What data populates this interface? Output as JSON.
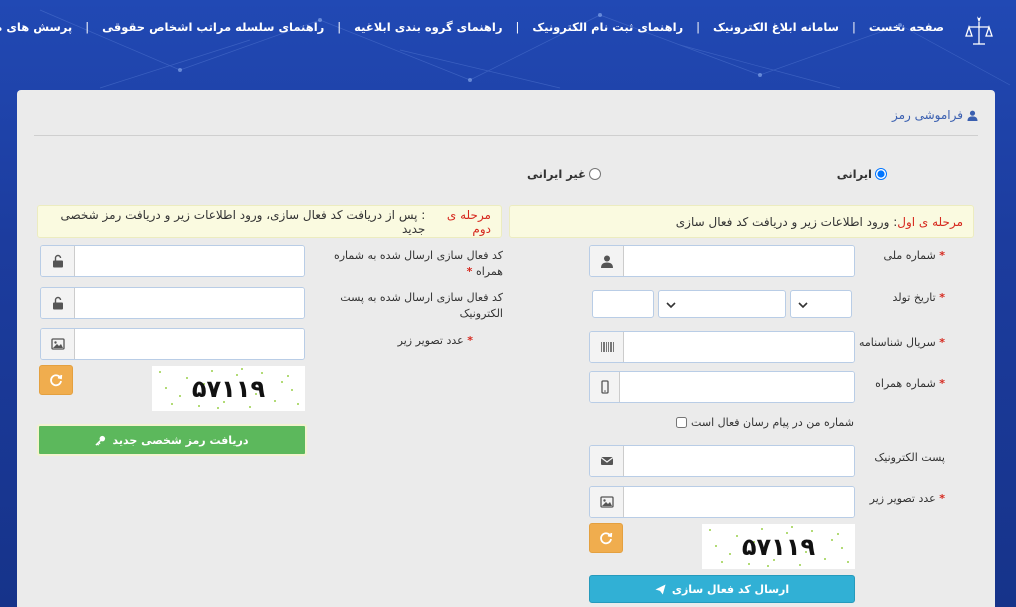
{
  "nav": {
    "home": "صفحه نخست",
    "system": "سامانه ابلاغ الکترونیک",
    "reg_guide": "راهنمای ثبت نام الکترونیک",
    "group_guide": "راهنمای گروه بندی ابلاغیه",
    "hierarchy_guide": "راهنمای سلسله مراتب اشخاص حقوقی",
    "faq": "پرسش های متداول",
    "separator": "|"
  },
  "panel": {
    "title": "فراموشی رمز"
  },
  "nationality": {
    "iranian": "ایرانی",
    "non_iranian": "غیر ایرانی",
    "selected": "iranian"
  },
  "step1": {
    "prefix": "مرحله ی اول",
    "text": " : ورود اطلاعات زیر و دریافت کد فعال سازی",
    "national_id_label": "شماره ملی",
    "birth_date_label": "تاریخ تولد",
    "birth_cert_serial_label": "سریال شناسنامه",
    "mobile_label": "شماره همراه",
    "messenger_label": "شماره من در پیام رسان فعال است",
    "email_label": "پست الکترونیک",
    "captcha_label": "عدد تصویر زیر",
    "captcha_value": "۵۷۱۱۹",
    "submit_label": "ارسال کد فعال سازی"
  },
  "step2": {
    "prefix": "مرحله ی دوم",
    "text": " : پس از دریافت کد فعال سازی، ورود اطلاعات زیر و دریافت رمز شخصی جدید",
    "sms_code_label": "کد فعال سازی ارسال شده به شماره همراه",
    "email_code_label": "کد فعال سازی ارسال شده به پست الکترونیک",
    "captcha_label": "عدد تصویر زیر",
    "captcha_value": "۵۷۱۱۹",
    "submit_label": "دریافت رمز شخصی جدید"
  },
  "required_mark": "*",
  "colors": {
    "brand_blue": "#1d3fa3",
    "accent_red": "#d6281e",
    "btn_blue": "#31b0d5",
    "btn_green": "#5cb85c",
    "btn_orange": "#f0ad4e"
  }
}
